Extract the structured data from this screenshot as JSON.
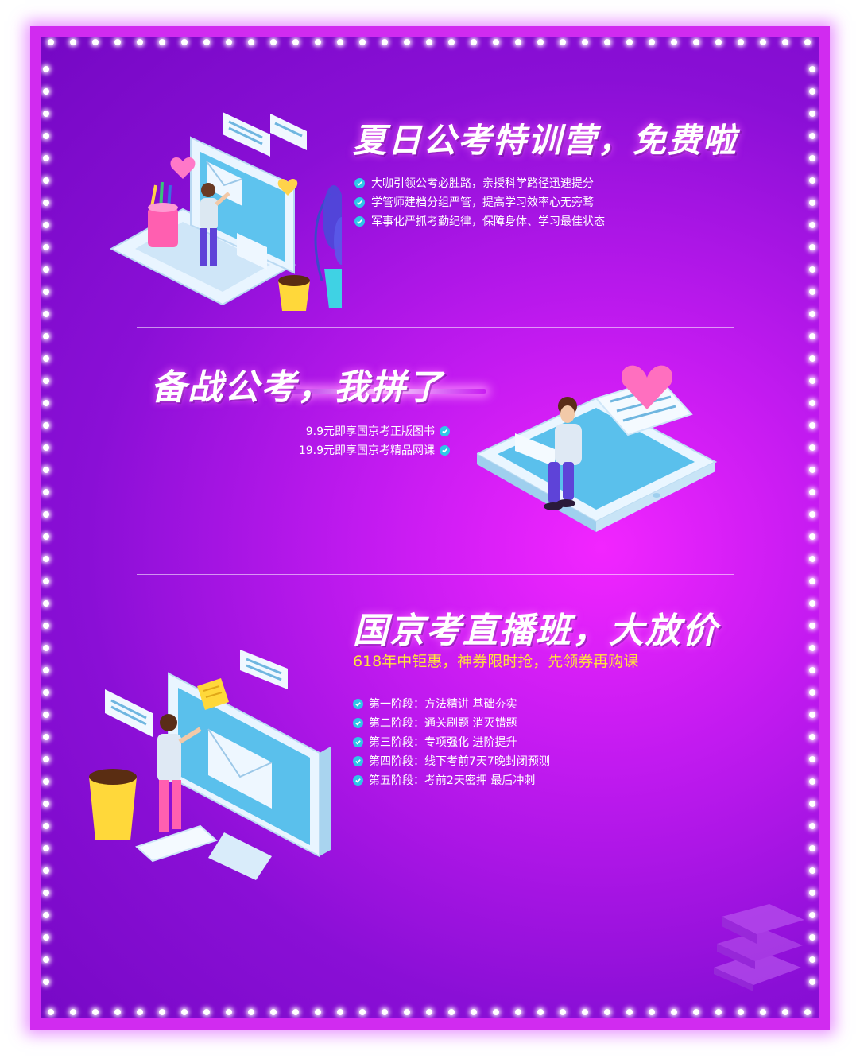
{
  "section1": {
    "title": "夏日公考特训营，免费啦",
    "bullets": [
      "大咖引领公考必胜路，亲授科学路径迅速提分",
      "学管师建档分组严管，提高学习效率心无旁骛",
      "军事化严抓考勤纪律，保障身体、学习最佳状态"
    ]
  },
  "section2": {
    "title": "备战公考，我拼了",
    "bullets": [
      "9.9元即享国京考正版图书",
      "19.9元即享国京考精品网课"
    ]
  },
  "section3": {
    "title": "国京考直播班，大放价",
    "promo": "618年中钜惠，神券限时抢，先领券再购课",
    "bullets": [
      "第一阶段：方法精讲 基础夯实",
      "第二阶段：通关刷题 消灭错题",
      "第三阶段：专项强化 进阶提升",
      "第四阶段：线下考前7天7晚封闭预测",
      "第五阶段：考前2天密押 最后冲刺"
    ]
  },
  "colors": {
    "frame": "#d12bf0",
    "background_center": "#f225ff",
    "background_edge": "#7508c4",
    "check": "#2ec7e8",
    "promo": "#ffe23b"
  },
  "icons": [
    "check-icon",
    "heart-icon",
    "chat-bubble-icon",
    "envelope-icon",
    "coffee-cup-icon",
    "plant-icon",
    "pencil-cup-icon",
    "books-icon"
  ]
}
